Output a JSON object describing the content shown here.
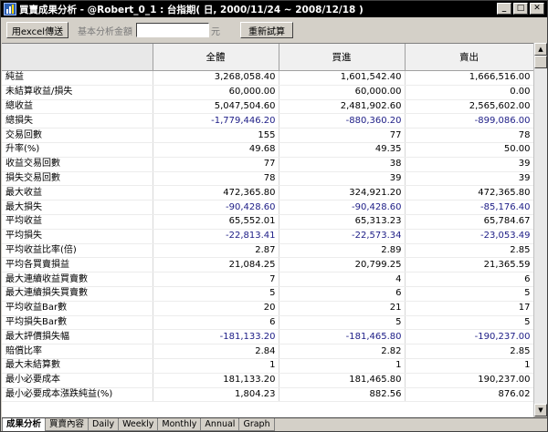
{
  "window": {
    "title_prefix": "買賣成果分析",
    "title_rest": " - @Robert_0_1 : 台指期( 日, 2000/11/24 ~ 2008/12/18 )",
    "icon": "chart-app-icon",
    "minimize": "_",
    "maximize": "□",
    "close": "✕"
  },
  "toolbar": {
    "export_label": "用excel傳送",
    "amount_label": "基本分析金額",
    "amount_value": "",
    "unit": "元",
    "recalc_label": "重新試算"
  },
  "table": {
    "headers": [
      "",
      "全體",
      "買進",
      "賣出"
    ],
    "rows": [
      {
        "label": "純益",
        "all": "3,268,058.40",
        "buy": "1,601,542.40",
        "sell": "1,666,516.00"
      },
      {
        "label": "未結算收益/損失",
        "all": "60,000.00",
        "buy": "60,000.00",
        "sell": "0.00"
      },
      {
        "label": "總收益",
        "all": "5,047,504.60",
        "buy": "2,481,902.60",
        "sell": "2,565,602.00"
      },
      {
        "label": "總損失",
        "all": "-1,779,446.20",
        "buy": "-880,360.20",
        "sell": "-899,086.00"
      },
      {
        "label": "交易回數",
        "all": "155",
        "buy": "77",
        "sell": "78"
      },
      {
        "label": "升率(%)",
        "all": "49.68",
        "buy": "49.35",
        "sell": "50.00"
      },
      {
        "label": "收益交易回數",
        "all": "77",
        "buy": "38",
        "sell": "39"
      },
      {
        "label": "損失交易回數",
        "all": "78",
        "buy": "39",
        "sell": "39"
      },
      {
        "label": "最大收益",
        "all": "472,365.80",
        "buy": "324,921.20",
        "sell": "472,365.80"
      },
      {
        "label": "最大損失",
        "all": "-90,428.60",
        "buy": "-90,428.60",
        "sell": "-85,176.40"
      },
      {
        "label": "平均收益",
        "all": "65,552.01",
        "buy": "65,313.23",
        "sell": "65,784.67"
      },
      {
        "label": "平均損失",
        "all": "-22,813.41",
        "buy": "-22,573.34",
        "sell": "-23,053.49"
      },
      {
        "label": "平均收益比率(倍)",
        "all": "2.87",
        "buy": "2.89",
        "sell": "2.85"
      },
      {
        "label": "平均各買賣損益",
        "all": "21,084.25",
        "buy": "20,799.25",
        "sell": "21,365.59"
      },
      {
        "label": "最大連續收益買賣數",
        "all": "7",
        "buy": "4",
        "sell": "6"
      },
      {
        "label": "最大連續損失買賣數",
        "all": "5",
        "buy": "6",
        "sell": "5"
      },
      {
        "label": "平均收益Bar數",
        "all": "20",
        "buy": "21",
        "sell": "17"
      },
      {
        "label": "平均損失Bar數",
        "all": "6",
        "buy": "5",
        "sell": "5"
      },
      {
        "label": "最大評價損失幅",
        "all": "-181,133.20",
        "buy": "-181,465.80",
        "sell": "-190,237.00"
      },
      {
        "label": "賠償比率",
        "all": "2.84",
        "buy": "2.82",
        "sell": "2.85"
      },
      {
        "label": "最大未結算數",
        "all": "1",
        "buy": "1",
        "sell": "1"
      },
      {
        "label": "最小必要成本",
        "all": "181,133.20",
        "buy": "181,465.80",
        "sell": "190,237.00"
      },
      {
        "label": "最小必要成本漲跌純益(%)",
        "all": "1,804.23",
        "buy": "882.56",
        "sell": "876.02"
      }
    ]
  },
  "tabs": [
    "成果分析",
    "買賣內容",
    "Daily",
    "Weekly",
    "Monthly",
    "Annual",
    "Graph"
  ],
  "active_tab": 0,
  "colors": {
    "negative": "#1c1c86",
    "titlebar": "#000000",
    "chrome": "#d4d0c8"
  }
}
